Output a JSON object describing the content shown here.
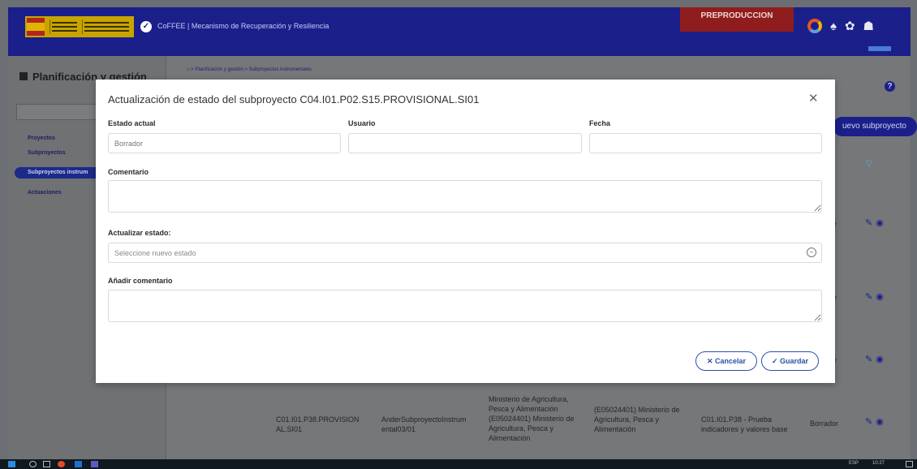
{
  "header": {
    "app_name": "CoFFEE",
    "app_title": "CoFFEE  |  Mecanismo de Recuperación y Resiliencia",
    "environment": "PREPRODUCCION",
    "colors": {
      "header_bg": "#1a1f8a",
      "env_badge": "#8f1d1d",
      "accent": "#2a52a8"
    }
  },
  "sidebar": {
    "title": "Planificación y gestión",
    "items": [
      {
        "label": "Proyectos"
      },
      {
        "label": "Subproyectos"
      },
      {
        "label": "Subproyectos instrum",
        "active": true
      },
      {
        "label": "Actuaciones"
      }
    ]
  },
  "breadcrumb": {
    "text": " > Planificación y gestión > Subproyectos instrumentales"
  },
  "page": {
    "new_button": "uevo subproyecto",
    "rows_status_partial": [
      "r",
      "r",
      "r"
    ],
    "last_row": {
      "code": "C01.I01.P38.PROVISION AL.SI01",
      "user": "AnderSubproyectoInstrum ental03/01",
      "org": "Ministerio de Agricultura, Pesca y Alimentación (E05024401) Ministerio de Agricultura, Pesca y Alimentación",
      "dest": "(E05024401) Ministerio de Agricultura, Pesca y Alimentación",
      "name": "C01.I01.P38 - Prueba indicadores y valores base",
      "status": "Borrador"
    }
  },
  "modal": {
    "title": "Actualización de estado del subproyecto C04.I01.P02.S15.PROVISIONAL.SI01",
    "estado_actual_label": "Estado actual",
    "estado_actual_value": "Borrador",
    "usuario_label": "Usuario",
    "usuario_value": "",
    "fecha_label": "Fecha",
    "fecha_value": "",
    "comentario_label": "Comentario",
    "actualizar_label": "Actualizar estado:",
    "actualizar_placeholder": "Seleccione nuevo estado",
    "anadir_label": "Añadir comentario",
    "cancel_label": "✕ Cancelar",
    "save_label": "✓ Guardar"
  },
  "taskbar": {
    "lang": "ESP",
    "time": "10:27"
  }
}
